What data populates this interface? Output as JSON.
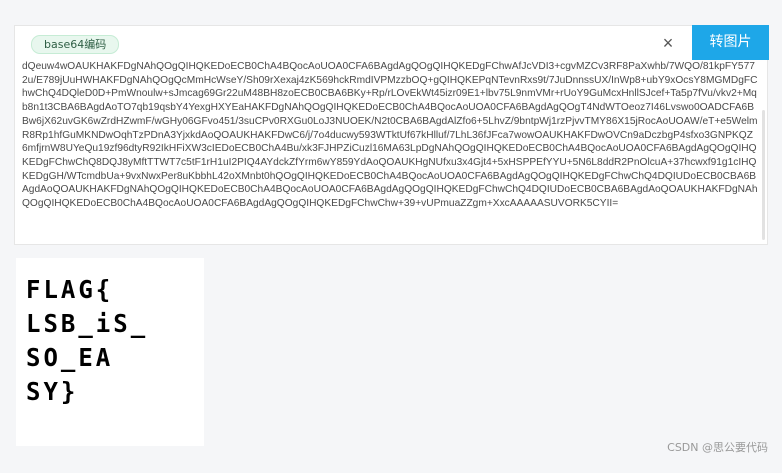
{
  "tool": {
    "tag_label": "base64编码",
    "clear_icon": "×",
    "convert_button_label": "转图片"
  },
  "input": {
    "value": "dQeuw4wOAUKHAKFDgNAhQOgQIHQKEDoECB0ChA4BQocAoUOA0CFA6BAgdAgQOgQIHQKEDgFChwAfJcVDI3+cgvMZCv3RF8PaXwhb/7WQO/81kpFY5772u/E789jUuHWHAKFDgNAhQOgQcMmHcWseY/Sh09rXexaj4zK569hckRmdIVPMzzbOQ+gQIHQKEPqNTevnRxs9t/7JuDnnssUX/InWp8+ubY9xOcsY8MGMDgFChwChQ4DQleD0D+PmWnoulw+sJmcag69Gr22uM48BH8zoECB0CBA6BKy+Rp/rLOvEkWt45izr09E1+lbv75L9nmVMr+rUoY9GuMcxHnllSJcef+Ta5p7fVu/vkv2+Mqb8n1t3CBA6BAgdAoTO7qb19qsbY4YexgHXYEaHAKFDgNAhQOgQIHQKEDoECB0ChA4BQocAoUOA0CFA6BAgdAgQOgT4NdWTOeoz7I46Lvswo0OADCFA6BBw6jX62uvGK6wZrdHZwmF/wGHy06GFvo451/3suCPv0RXGu0LoJ3NUOEK/N2t0CBA6BAgdAlZfo6+5LhvZ/9bntpWj1rzPjvvTMY86X15jRocAoUOAW/eT+e5WelmR8Rp1hfGuMKNDwOqhTzPDnA3YjxkdAoQOAUKHAKFDwC6/j/7o4ducwy593WTktUf67kHlluf/7LhL36fJFca7wowOAUKHAKFDwOVCn9aDczbgP4sfxo3GNPKQZ6mfjrnW8UYeQu19zf96dtyR92IkHFiXW3cIEDoECB0ChA4Bu/xk3FJHPZiCuzl16MA63LpDgNAhQOgQIHQKEDoECB0ChA4BQocAoUOA0CFA6BAgdAgQOgQIHQKEDgFChwChQ8DQJ8yMftTTWT7c5tF1rH1uI2PIQ4AYdckZfYrm6wY859YdAoQOAUKHgNUfxu3x4Gjt4+5xHSPPEfYYU+5N6L8ddR2PnOlcuA+37hcwxf91g1cIHQKEDgGH/WTcmdbUa+9vxNwxPer8uKbbhL42oXMnbt0hQOgQIHQKEDoECB0ChA4BQocAoUOA0CFA6BAgdAgQOgQIHQKEDgFChwChQ4DQIUDoECB0CBA6BAgdAoQOAUKHAKFDgNAhQOgQIHQKEDoECB0ChA4BQocAoUOA0CFA6BAgdAgQOgQIHQKEDgFChwChQ4DQIUDoECB0CBA6BAgdAoQOAUKHAKFDgNAhQOgQIHQKEDoECB0ChA4BQocAoUOA0CFA6BAgdAgQOgQIHQKEDgFChwChw+39+vUPmuaZZgm+XxcAAAAASUVORK5CYII=",
    "value_lines": [
      "dQeuw4wOAUKHAKFDgNAhQOgQIHQKEDoECB0ChA4BQocAoUOA0CFA6BAgdAgQOgQIHQKEDgFChwAfJcVDI3+cgvMZCv3RF8PaXwhb/7WQO/81kpF",
      "Y5772u/E789jUuHWHAKFDgNAhQOgQcMmHcWseY/Sh09rXexaj4zK569hckRmdIVPMzzbOQ+gQIHQKEPqNTevnRxs9t/7JuDnnssUX/InWp8+ubY9xOcsY8",
      "MGMDgFChwChQ4DQleD0D+PmWnoulw+sJmcag69Gr22uM48BH8zoECB0CBA6BKy+Rp/rLOvEkWt45izr09E1+lbv75L9nmVMr+rUoY9GuMcxHnllSJcef+",
      "Ta5p7fVu/vkv2+Mqb8n1t3CBA6BAgdAoTO7qb19qsbY4YexgHXYEaHAKFDgNAhQOgQIHQKEDoECB0ChA4BQocAoUOA0CFA6BAgdAgQOgT4NdWTOeoz",
      "7I46Lvswo0OADCFA6BBw6jX62uvGK6wZrdHZwmF/wGHy06GFvo451/3suCPv0RXGu0LoJ3NUOEK/N2t0CBA6BAgdAlZfo6+5LhvZ/9bntpWj1rzPjvvTMY86",
      "X15jRocAoUOAW/eT+e5WelmR8Rp1hfGuMKNDwOqhTzPDnA3YjxkdAoQOAUKHAKFDwC6/j/7o4ducwy593WTktUf67kHlluf/7LhL36fJFca7wowOAUKHA",
      "KFDwOVCn9aDczbgP4sfxo3GNPKQZ6mfjrnW8UYeQu19zf96dtyR92IkHFiXW3cIEDoECB0ChA4Bu/xk3FJHPZiCuzl16MA63LpDgNAhQOgQIHQKEDoECB0C",
      "hA4BQocAoUOA0CFA6BAgdAgQOgQIHQKEDgFChwChQ8DQJ8yMftTTWT7c5tF1rH1uI2PIQ4AYdckZfYrm6wY859YdAoQOAUKHgNUfxu3x4Gjt4+5xHSPP",
      "EfYYU+5N6L8ddR2PnOlcuA+37hcwxf91g1cIHQKEDgGH/WTcmdbUa+9vxNwxPer8uKbbhL42oXMnbt0hQOgQIHQKEDoECB0ChA4BQocAoUOA0CFA6BAgdAgQOgQIHQKEDgFChwChQ4DQIUDoECB0CBA6BAgdAoQOAUKHAKFDgNAhQOgQIHQKEDoECB0ChA4BQocAoUOA0CFA6BAgdAgQOgQIHQKEDgFChwChQ4DQIUDoECB0CBA6BAgdAoQOAUKHAKFDgNAhQOgQIHQKEDoECB0ChA4BQocAoUOA0CFA6BAgdAgQOgQIHQKEDgFChwChw+39+vUPmuaZZgm+XxcAAAAASUVORK5CYII="
    ]
  },
  "result_image": {
    "lines": [
      "FLAG{",
      "LSB_iS_",
      "SO_EA",
      "SY}"
    ]
  },
  "watermark": "CSDN @思公要代码",
  "colors": {
    "accent": "#1ea7e8",
    "tag_bg": "#e8f7ee",
    "text": "#4a4a4a",
    "background": "#f5f6f8"
  },
  "icons": {
    "clear": "close-icon"
  }
}
